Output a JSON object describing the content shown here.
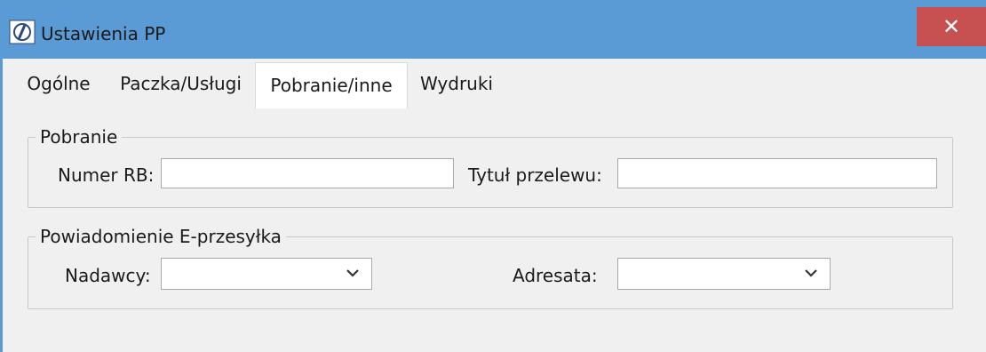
{
  "window": {
    "title": "Ustawienia PP",
    "close_glyph": "✕",
    "app_icon": "app-logo-icon"
  },
  "tabs": [
    {
      "label": "Ogólne",
      "active": false
    },
    {
      "label": "Paczka/Usługi",
      "active": false
    },
    {
      "label": "Pobranie/inne",
      "active": true
    },
    {
      "label": "Wydruki",
      "active": false
    }
  ],
  "pobranie": {
    "legend": "Pobranie",
    "numer_rb_label": "Numer RB:",
    "numer_rb_value": "",
    "tytul_label": "Tytuł przelewu:",
    "tytul_value": ""
  },
  "powiadomienie": {
    "legend": "Powiadomienie E-przesyłka",
    "nadawcy_label": "Nadawcy:",
    "nadawcy_value": "",
    "adresata_label": "Adresata:",
    "adresata_value": ""
  },
  "colors": {
    "titlebar": "#5b9bd5",
    "close": "#c75050",
    "panel": "#f0f0f0"
  }
}
